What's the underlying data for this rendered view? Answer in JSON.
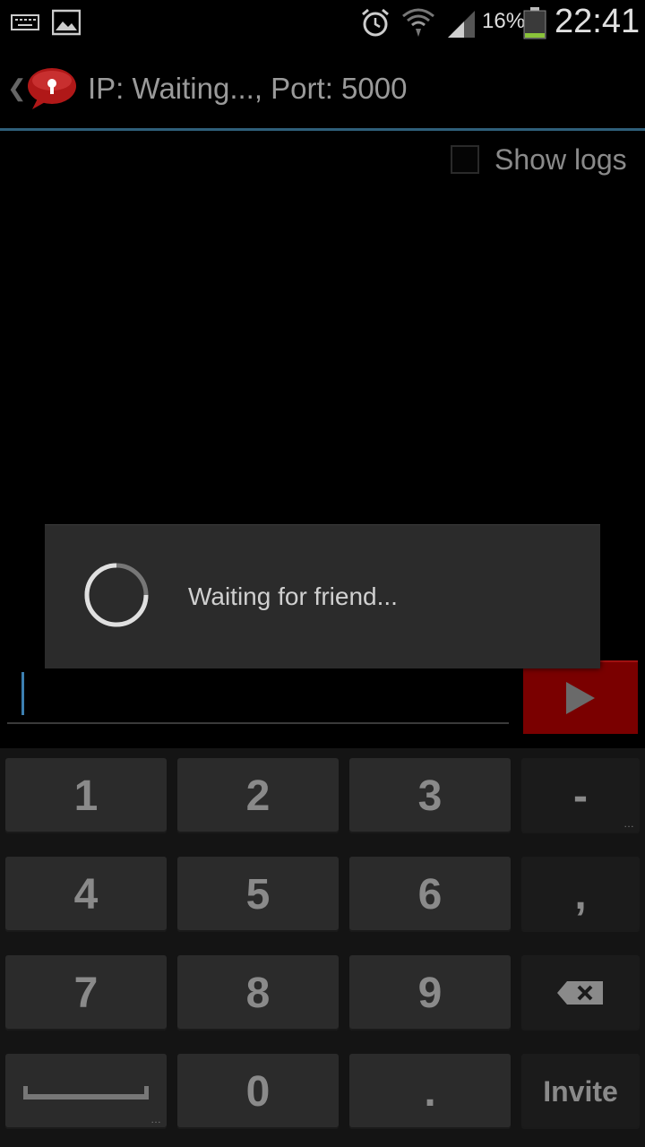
{
  "status_bar": {
    "battery_percent": "16%",
    "time": "22:41",
    "icons": [
      "keyboard-icon",
      "image-icon",
      "alarm-icon",
      "wifi-icon",
      "signal-icon",
      "battery-icon"
    ]
  },
  "action_bar": {
    "title": "IP: Waiting..., Port: 5000",
    "back_glyph": "❮"
  },
  "logs": {
    "label": "Show logs",
    "checked": false
  },
  "message": {
    "value": ""
  },
  "dialog": {
    "message": "Waiting for friend..."
  },
  "keyboard": {
    "row1": [
      "1",
      "2",
      "3",
      "-"
    ],
    "row2": [
      "4",
      "5",
      "6",
      ","
    ],
    "row3": [
      "7",
      "8",
      "9"
    ],
    "row4": [
      "0",
      ".",
      "Invite"
    ]
  },
  "colors": {
    "accent_blue": "#2f5f7a",
    "send_red": "#7a0000",
    "battery_green": "#8ac33a"
  }
}
